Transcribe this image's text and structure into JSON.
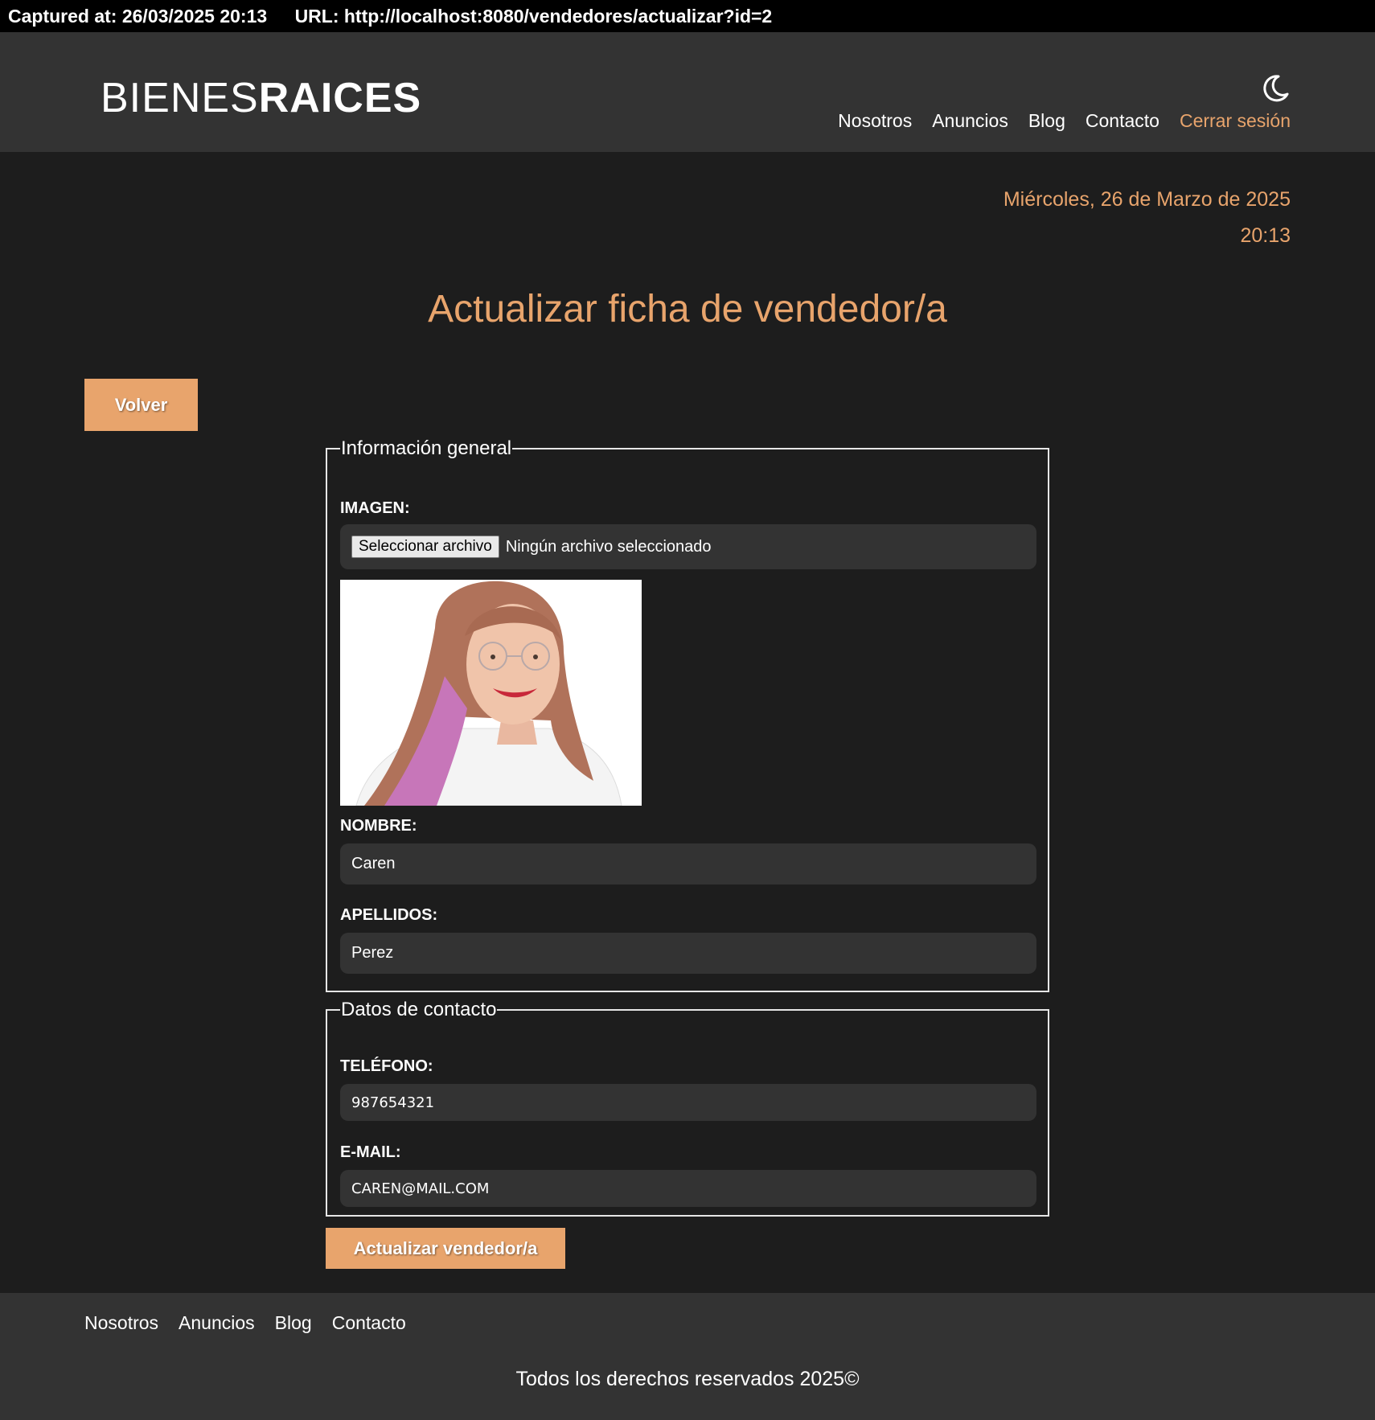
{
  "capture": {
    "captured_at": "Captured at: 26/03/2025 20:13",
    "url": "URL: http://localhost:8080/vendedores/actualizar?id=2"
  },
  "header": {
    "logo_light": "BIENES",
    "logo_bold": "RAICES",
    "theme_icon": "moon-icon",
    "nav": [
      "Nosotros",
      "Anuncios",
      "Blog",
      "Contacto"
    ],
    "logout": "Cerrar sesión"
  },
  "datetime": {
    "date": "Miércoles, 26 de Marzo de 2025",
    "time": "20:13"
  },
  "page": {
    "title": "Actualizar ficha de vendedor/a",
    "back_button": "Volver"
  },
  "form": {
    "general": {
      "legend": "Información general",
      "image_label": "IMAGEN:",
      "file_button": "Seleccionar archivo",
      "file_status": "Ningún archivo seleccionado",
      "name_label": "NOMBRE:",
      "name_value": "Caren",
      "surname_label": "APELLIDOS:",
      "surname_value": "Perez"
    },
    "contact": {
      "legend": "Datos de contacto",
      "phone_label": "TELÉFONO:",
      "phone_value": "987654321",
      "email_label": "E-MAIL:",
      "email_value": "CAREN@MAIL.COM"
    },
    "submit": "Actualizar vendedor/a"
  },
  "footer": {
    "nav": [
      "Nosotros",
      "Anuncios",
      "Blog",
      "Contacto"
    ],
    "copyright": "Todos los derechos reservados 2025©"
  },
  "colors": {
    "accent": "#e8a46c",
    "background": "#1d1d1d",
    "surface": "#333333"
  }
}
